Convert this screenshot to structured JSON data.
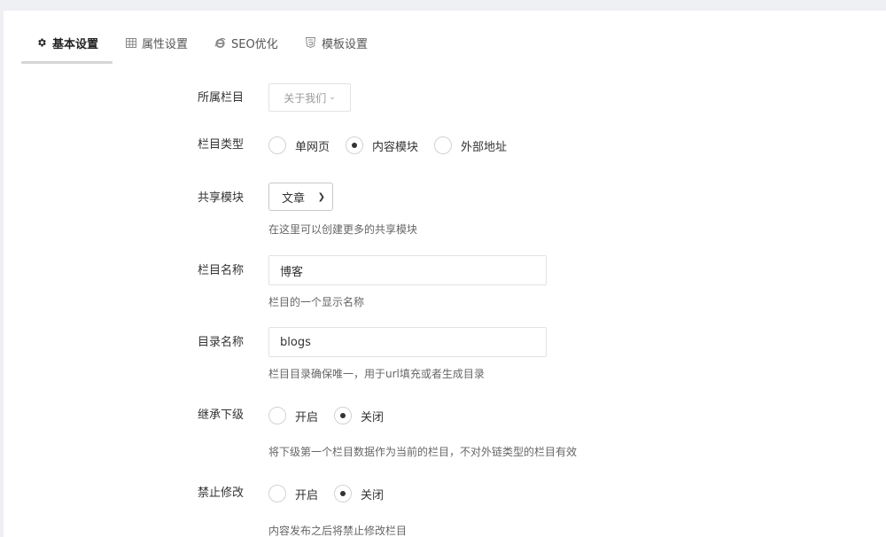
{
  "tabs": [
    {
      "label": "基本设置",
      "icon": "gear-icon",
      "active": true
    },
    {
      "label": "属性设置",
      "icon": "grid-icon",
      "active": false
    },
    {
      "label": "SEO优化",
      "icon": "ie-icon",
      "active": false
    },
    {
      "label": "模板设置",
      "icon": "html5-icon",
      "active": false
    }
  ],
  "form": {
    "parent_column": {
      "label": "所属栏目",
      "value": "关于我们"
    },
    "column_type": {
      "label": "栏目类型",
      "options": [
        "单网页",
        "内容模块",
        "外部地址"
      ],
      "selected": "内容模块"
    },
    "shared_module": {
      "label": "共享模块",
      "value": "文章",
      "hint": "在这里可以创建更多的共享模块"
    },
    "column_name": {
      "label": "栏目名称",
      "value": "博客",
      "hint": "栏目的一个显示名称"
    },
    "dir_name": {
      "label": "目录名称",
      "value": "blogs",
      "hint": "栏目目录确保唯一，用于url填充或者生成目录"
    },
    "inherit_sub": {
      "label": "继承下级",
      "options": [
        "开启",
        "关闭"
      ],
      "selected": "关闭",
      "hint": "将下级第一个栏目数据作为当前的栏目，不对外链类型的栏目有效"
    },
    "forbid_edit": {
      "label": "禁止修改",
      "options": [
        "开启",
        "关闭"
      ],
      "selected": "关闭",
      "hint": "内容发布之后将禁止修改栏目"
    }
  }
}
